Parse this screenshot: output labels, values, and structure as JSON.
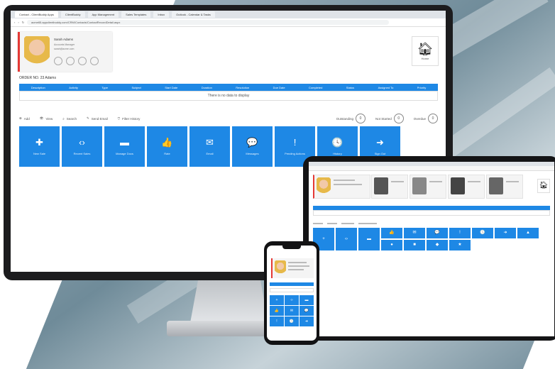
{
  "browser": {
    "tabs": [
      "Contact - ClientBuddy Apps",
      "ClientBuddy",
      "App Management",
      "Sales Templates",
      "Inbox",
      "Outlook - Calendar & Tasks"
    ],
    "url": "acme65.appclientbuddy.com/CRM/Contacts/ContactRecordDetail.aspx"
  },
  "contact_card": {
    "name": "Sarah Adams",
    "detail_1": "Accounts Manager",
    "detail_2": "sarah@acme.com"
  },
  "home": {
    "label": "Home"
  },
  "record_title": "ORDER NO. 23 Adams",
  "grid": {
    "columns": [
      "Description",
      "Activity",
      "Type",
      "Subject",
      "Start Date",
      "Duration",
      "Resolution",
      "Due Date",
      "Completed",
      "Status",
      "Assigned To",
      "Priority"
    ],
    "empty_message": "There is no data to display"
  },
  "toolbar": {
    "items": [
      "Add",
      "View",
      "Search",
      "Send Email",
      "Filter History"
    ],
    "counters": [
      {
        "label": "Outstanding",
        "value": "0"
      },
      {
        "label": "Not Started",
        "value": "0"
      },
      {
        "label": "Overdue",
        "value": "0"
      }
    ]
  },
  "tiles": [
    {
      "icon": "plus-icon",
      "glyph": "✚",
      "label": "New Sale"
    },
    {
      "icon": "code-icon",
      "glyph": "‹›",
      "label": "Recent Sales"
    },
    {
      "icon": "list-icon",
      "glyph": "▬",
      "label": "Manage Docs"
    },
    {
      "icon": "thumbs-up-icon",
      "glyph": "👍",
      "label": "Rate"
    },
    {
      "icon": "mail-icon",
      "glyph": "✉",
      "label": "Email"
    },
    {
      "icon": "chat-icon",
      "glyph": "💬",
      "label": "Messages"
    },
    {
      "icon": "alert-icon",
      "glyph": "!",
      "label": "Pending Actions"
    },
    {
      "icon": "clock-icon",
      "glyph": "🕓",
      "label": "History"
    },
    {
      "icon": "sign-out-icon",
      "glyph": "➜",
      "label": "Sign Out"
    }
  ],
  "tablet": {
    "tiles": [
      "+",
      "‹›",
      "▬",
      "👍",
      "✉",
      "💬",
      "!",
      "🕓",
      "➜",
      "▲",
      "●",
      "■",
      "◆",
      "★",
      "☰",
      "⚑"
    ]
  },
  "phone": {
    "tiles": [
      "+",
      "‹›",
      "▬",
      "👍",
      "✉",
      "💬",
      "!",
      "🕓",
      "➜"
    ]
  },
  "colors": {
    "accent": "#1e88e5",
    "flag": "#e53935",
    "bezel": "#1c1c1e"
  }
}
